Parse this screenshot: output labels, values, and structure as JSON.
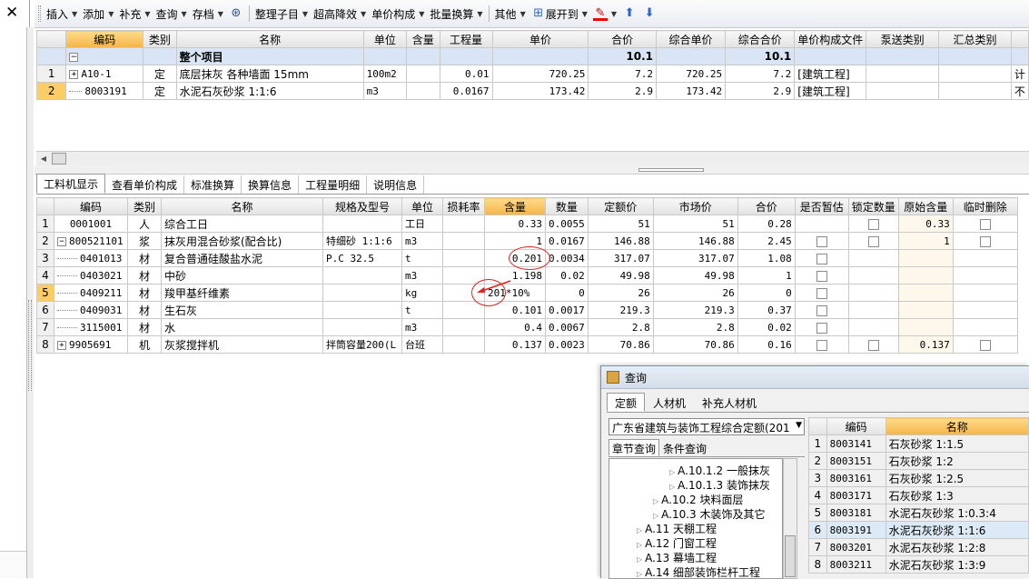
{
  "toolbar": {
    "items": [
      {
        "label": "插入"
      },
      {
        "label": "添加"
      },
      {
        "label": "补充"
      },
      {
        "label": "查询"
      },
      {
        "label": "存档"
      },
      {
        "label": "整理子目"
      },
      {
        "label": "超高降效"
      },
      {
        "label": "单价构成"
      },
      {
        "label": "批量换算"
      },
      {
        "label": "其他"
      },
      {
        "label": "展开到"
      }
    ]
  },
  "top_grid": {
    "headers": [
      "编码",
      "类别",
      "名称",
      "单位",
      "含量",
      "工程量",
      "单价",
      "合价",
      "综合单价",
      "综合合价",
      "单价构成文件",
      "泵送类别",
      "汇总类别"
    ],
    "group_row": {
      "name": "整个项目",
      "total": "10.1",
      "comp_total": "10.1"
    },
    "rows": [
      {
        "no": "1",
        "code": "A10-1",
        "type": "定",
        "name": "底层抹灰 各种墙面 15mm",
        "unit": "100m2",
        "qty": "0.01",
        "price": "720.25",
        "total": "7.2",
        "comp_price": "720.25",
        "comp_total": "7.2",
        "file": "[建筑工程]",
        "pump": "",
        "sum": "计"
      },
      {
        "no": "2",
        "code": "8003191",
        "type": "定",
        "name": "水泥石灰砂浆 1:1:6",
        "unit": "m3",
        "qty": "0.0167",
        "price": "173.42",
        "total": "2.9",
        "comp_price": "173.42",
        "comp_total": "2.9",
        "file": "[建筑工程]",
        "pump": "",
        "sum": "不"
      }
    ]
  },
  "tabs": [
    "工料机显示",
    "查看单价构成",
    "标准换算",
    "换算信息",
    "工程量明细",
    "说明信息"
  ],
  "bottom_grid": {
    "headers": [
      "编码",
      "类别",
      "名称",
      "规格及型号",
      "单位",
      "损耗率",
      "含量",
      "数量",
      "定额价",
      "市场价",
      "合价",
      "是否暂估",
      "锁定数量",
      "原始含量",
      "临时删除"
    ],
    "rows": [
      {
        "no": "1",
        "code": "0001001",
        "type": "人",
        "name": "综合工日",
        "spec": "",
        "unit": "工日",
        "loss": "",
        "content": "0.33",
        "qty": "0.0055",
        "quota": "51",
        "market": "51",
        "total": "0.28",
        "orig": "0.33"
      },
      {
        "no": "2",
        "code": "800521101",
        "type": "浆",
        "name": "抹灰用混合砂浆(配合比)",
        "spec": "特细砂 1:1:6",
        "unit": "m3",
        "loss": "",
        "content": "1",
        "qty": "0.0167",
        "quota": "146.88",
        "market": "146.88",
        "total": "2.45",
        "orig": "1"
      },
      {
        "no": "3",
        "code": "0401013",
        "type": "材",
        "name": "复合普通硅酸盐水泥",
        "spec": "P.C 32.5",
        "unit": "t",
        "loss": "",
        "content": "0.201",
        "qty": "0.0034",
        "quota": "317.07",
        "market": "317.07",
        "total": "1.08",
        "orig": ""
      },
      {
        "no": "4",
        "code": "0403021",
        "type": "材",
        "name": "中砂",
        "spec": "",
        "unit": "m3",
        "loss": "",
        "content": "1.198",
        "qty": "0.02",
        "quota": "49.98",
        "market": "49.98",
        "total": "1",
        "orig": ""
      },
      {
        "no": "5",
        "code": "0409211",
        "type": "材",
        "name": "羧甲基纤维素",
        "spec": "",
        "unit": "kg",
        "loss": "",
        "content": "201*10%",
        "qty": "0",
        "quota": "26",
        "market": "26",
        "total": "0",
        "orig": ""
      },
      {
        "no": "6",
        "code": "0409031",
        "type": "材",
        "name": "生石灰",
        "spec": "",
        "unit": "t",
        "loss": "",
        "content": "0.101",
        "qty": "0.0017",
        "quota": "219.3",
        "market": "219.3",
        "total": "0.37",
        "orig": ""
      },
      {
        "no": "7",
        "code": "3115001",
        "type": "材",
        "name": "水",
        "spec": "",
        "unit": "m3",
        "loss": "",
        "content": "0.4",
        "qty": "0.0067",
        "quota": "2.8",
        "market": "2.8",
        "total": "0.02",
        "orig": ""
      },
      {
        "no": "8",
        "code": "9905691",
        "type": "机",
        "name": "灰浆搅拌机",
        "spec": "拌筒容量200(L",
        "unit": "台班",
        "loss": "",
        "content": "0.137",
        "qty": "0.0023",
        "quota": "70.86",
        "market": "70.86",
        "total": "0.16",
        "orig": "0.137"
      }
    ]
  },
  "dialog": {
    "title": "查询",
    "tabs": [
      "定额",
      "人材机",
      "补充人材机"
    ],
    "select_value": "广东省建筑与装饰工程综合定额(201",
    "subtabs": [
      "章节查询",
      "条件查询"
    ],
    "tree": [
      {
        "label": "A.10.1.2 一般抹灰"
      },
      {
        "label": "A.10.1.3 装饰抹灰"
      },
      {
        "label": "A.10.2 块料面层"
      },
      {
        "label": "A.10.3 木装饰及其它"
      },
      {
        "label": "A.11 天棚工程"
      },
      {
        "label": "A.12 门窗工程"
      },
      {
        "label": "A.13 幕墙工程"
      },
      {
        "label": "A.14 细部装饰栏杆工程"
      }
    ],
    "grid_headers": [
      "编码",
      "名称"
    ],
    "grid_rows": [
      {
        "no": "1",
        "code": "8003141",
        "name": "石灰砂浆 1:1.5"
      },
      {
        "no": "2",
        "code": "8003151",
        "name": "石灰砂浆 1:2"
      },
      {
        "no": "3",
        "code": "8003161",
        "name": "石灰砂浆 1:2.5"
      },
      {
        "no": "4",
        "code": "8003171",
        "name": "石灰砂浆 1:3"
      },
      {
        "no": "5",
        "code": "8003181",
        "name": "水泥石灰砂浆 1:0.3:4"
      },
      {
        "no": "6",
        "code": "8003191",
        "name": "水泥石灰砂浆 1:1:6"
      },
      {
        "no": "7",
        "code": "8003201",
        "name": "水泥石灰砂浆 1:2:8"
      },
      {
        "no": "8",
        "code": "8003211",
        "name": "水泥石灰砂浆 1:3:9"
      }
    ]
  }
}
